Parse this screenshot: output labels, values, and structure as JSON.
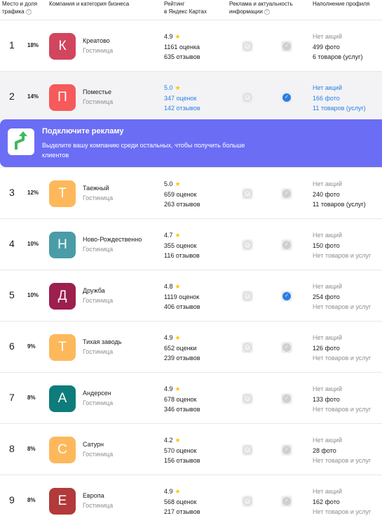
{
  "header": {
    "col1": "Место и доля",
    "col1b": "трафика",
    "col2": "Компания и категория бизнеса",
    "col3": "Рейтинг",
    "col3b": "в Яндекс Картах",
    "col4": "Реклама и актуальность",
    "col4b": "информации",
    "col5": "Наполнение профиля"
  },
  "ad": {
    "title": "Подключите рекламу",
    "text": "Выделите вашу компанию среди остальных, чтобы получить больше клиентов",
    "icon": "growth-arrow-icon"
  },
  "colors": {
    "accent": "#2a7fe4",
    "banner": "#6b6df5",
    "star": "#fcc400"
  },
  "rows": [
    {
      "rank": "1",
      "share": "18%",
      "letter": "К",
      "color": "#d1465e",
      "name": "Креатово",
      "category": "Гостиница",
      "rating": "4.9",
      "ratings_count": "1161 оценка",
      "reviews": "635 отзывов",
      "ad_on": false,
      "info_on": false,
      "promo": "Нет акций",
      "photos": "499 фото",
      "goods": "6 товаров (услуг)"
    },
    {
      "rank": "2",
      "share": "14%",
      "letter": "П",
      "color": "#f65a5a",
      "name": "Поместье",
      "category": "Гостиница",
      "rating": "5.0",
      "ratings_count": "347 оценок",
      "reviews": "142 отзывов",
      "ad_on": false,
      "info_on": true,
      "promo": "Нет акций",
      "photos": "166 фото",
      "goods": "11 товаров (услуг)"
    },
    {
      "rank": "3",
      "share": "12%",
      "letter": "Т",
      "color": "#fdb85c",
      "name": "Таежный",
      "category": "Гостиница",
      "rating": "5.0",
      "ratings_count": "659 оценок",
      "reviews": "263 отзывов",
      "ad_on": false,
      "info_on": false,
      "promo": "Нет акций",
      "photos": "240 фото",
      "goods": "11 товаров (услуг)"
    },
    {
      "rank": "4",
      "share": "10%",
      "letter": "Н",
      "color": "#4a9ca7",
      "name": "Ново-Рождественно",
      "category": "Гостиница",
      "rating": "4.7",
      "ratings_count": "355 оценок",
      "reviews": "116 отзывов",
      "ad_on": false,
      "info_on": false,
      "promo": "Нет акций",
      "photos": "150 фото",
      "goods": "Нет товаров и услуг"
    },
    {
      "rank": "5",
      "share": "10%",
      "letter": "Д",
      "color": "#9c1f4e",
      "name": "Дружба",
      "category": "Гостиница",
      "rating": "4.8",
      "ratings_count": "1119 оценок",
      "reviews": "406 отзывов",
      "ad_on": false,
      "info_on": true,
      "promo": "Нет акций",
      "photos": "254 фото",
      "goods": "Нет товаров и услуг"
    },
    {
      "rank": "6",
      "share": "9%",
      "letter": "Т",
      "color": "#fdb85c",
      "name": "Тихая заводь",
      "category": "Гостиница",
      "rating": "4.9",
      "ratings_count": "652 оценки",
      "reviews": "239 отзывов",
      "ad_on": false,
      "info_on": false,
      "promo": "Нет акций",
      "photos": "126 фото",
      "goods": "Нет товаров и услуг"
    },
    {
      "rank": "7",
      "share": "8%",
      "letter": "А",
      "color": "#0e7c7b",
      "name": "Андерсен",
      "category": "Гостиница",
      "rating": "4.9",
      "ratings_count": "678 оценок",
      "reviews": "346 отзывов",
      "ad_on": false,
      "info_on": false,
      "promo": "Нет акций",
      "photos": "133 фото",
      "goods": "Нет товаров и услуг"
    },
    {
      "rank": "8",
      "share": "8%",
      "letter": "С",
      "color": "#fdb85c",
      "name": "Сатурн",
      "category": "Гостиница",
      "rating": "4.2",
      "ratings_count": "570 оценок",
      "reviews": "156 отзывов",
      "ad_on": false,
      "info_on": false,
      "promo": "Нет акций",
      "photos": "28 фото",
      "goods": "Нет товаров и услуг"
    },
    {
      "rank": "9",
      "share": "8%",
      "letter": "Е",
      "color": "#b23a3a",
      "name": "Европа",
      "category": "Гостиница",
      "rating": "4.9",
      "ratings_count": "568 оценок",
      "reviews": "217 отзывов",
      "ad_on": false,
      "info_on": false,
      "promo": "Нет акций",
      "photos": "162 фото",
      "goods": "Нет товаров и услуг"
    }
  ]
}
